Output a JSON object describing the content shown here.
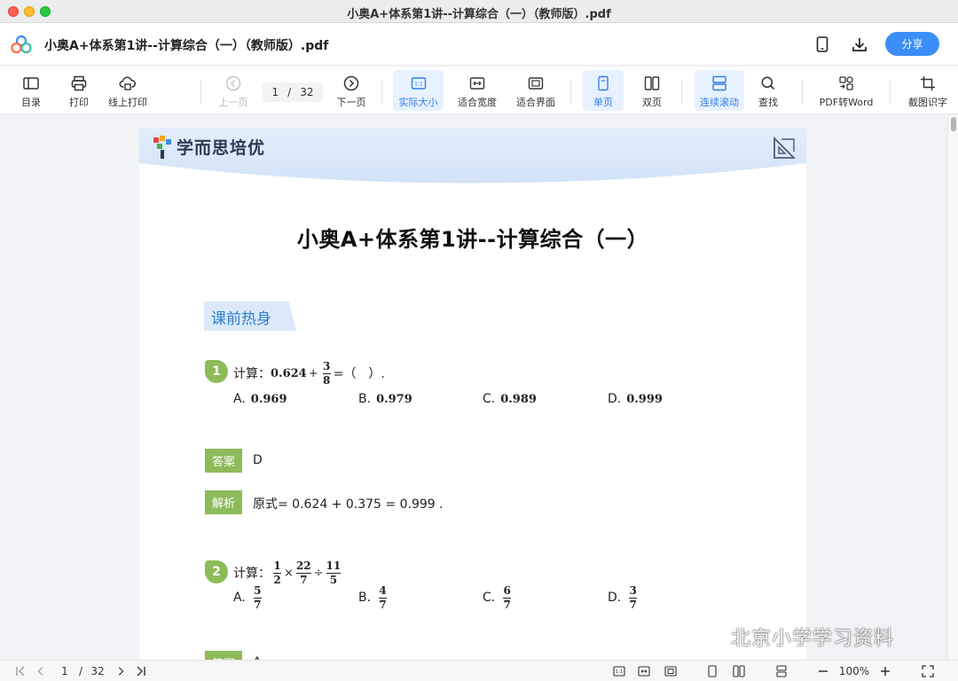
{
  "window": {
    "title": "小奥A+体系第1讲--计算综合（一）（教师版）.pdf"
  },
  "header": {
    "doc_title": "小奥A+体系第1讲--计算综合（一）（教师版）.pdf",
    "share_label": "分享"
  },
  "toolbar": {
    "toc": "目录",
    "print": "打印",
    "online_print": "线上打印",
    "prev_page": "上一页",
    "page_current": "1",
    "page_sep": "/",
    "page_total": "32",
    "next_page": "下一页",
    "actual_size": "实际大小",
    "fit_width": "适合宽度",
    "fit_page": "适合界面",
    "single_page": "单页",
    "double_page": "双页",
    "continuous_scroll": "连续滚动",
    "find": "查找",
    "pdf_to_word": "PDF转Word",
    "ocr": "截图识字"
  },
  "document": {
    "brand": "学而思培优",
    "title": "小奥A+体系第1讲--计算综合（一）",
    "section": "课前热身",
    "q1": {
      "num": "1",
      "prefix": "计算：",
      "expr_a": "0.624",
      "plus": "+",
      "frac_num": "3",
      "frac_den": "8",
      "tail": "=（　）.",
      "options": [
        {
          "letter": "A.",
          "value": "0.969"
        },
        {
          "letter": "B.",
          "value": "0.979"
        },
        {
          "letter": "C.",
          "value": "0.989"
        },
        {
          "letter": "D.",
          "value": "0.999"
        }
      ],
      "answer_label": "答案",
      "answer": "D",
      "analysis_label": "解析",
      "analysis": "原式= 0.624 + 0.375 = 0.999 ."
    },
    "q2": {
      "num": "2",
      "prefix": "计算：",
      "f1_num": "1",
      "f1_den": "2",
      "times": "×",
      "f2_num": "22",
      "f2_den": "7",
      "div": "÷",
      "f3_num": "11",
      "f3_den": "5",
      "options": [
        {
          "letter": "A.",
          "num": "5",
          "den": "7"
        },
        {
          "letter": "B.",
          "num": "4",
          "den": "7"
        },
        {
          "letter": "C.",
          "num": "6",
          "den": "7"
        },
        {
          "letter": "D.",
          "num": "3",
          "den": "7"
        }
      ],
      "answer_label": "答案",
      "answer": "A"
    }
  },
  "bottombar": {
    "page_current": "1",
    "page_sep": "/",
    "page_total": "32",
    "zoom": "100%"
  },
  "watermark": "北京小学学习资料",
  "colors": {
    "accent": "#3b8ef5",
    "green": "#8dbb5a",
    "section_blue": "#2f7fce"
  }
}
